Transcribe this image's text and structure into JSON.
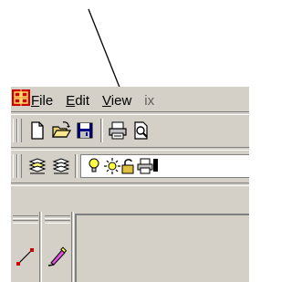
{
  "menu": {
    "file": {
      "mnemonic": "F",
      "rest": "ile"
    },
    "edit": {
      "mnemonic": "E",
      "rest": "dit"
    },
    "view": {
      "mnemonic": "V",
      "rest": "iew"
    },
    "clipped": "ix"
  },
  "toolbar_icons": [
    "new-document-icon",
    "open-folder-icon",
    "save-disk-icon",
    "print-icon",
    "print-preview-icon"
  ],
  "toolbar2_icons": [
    "layers-up-icon",
    "layers-icon",
    "lightbulb-icon",
    "sun-icon",
    "padlock-icon",
    "printer-small-icon"
  ],
  "side_icons": [
    "line-tool-icon",
    "pen-tool-icon"
  ],
  "colors": {
    "chrome": "#d4d0c8",
    "shadow": "#808080",
    "highlight": "#ffffff",
    "save_icon": "#000080",
    "app_icon_red": "#cc0000"
  }
}
